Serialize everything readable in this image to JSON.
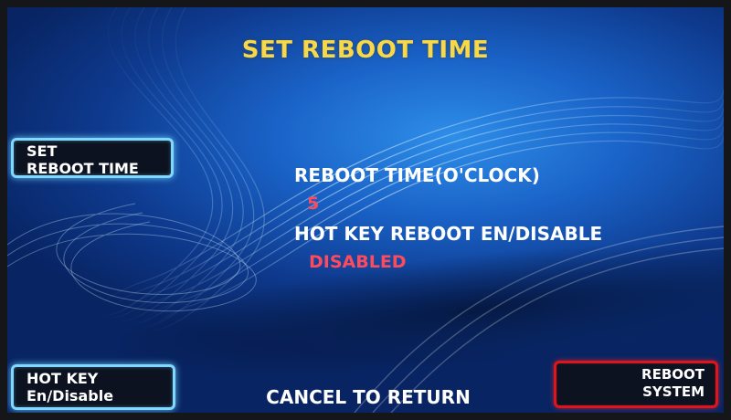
{
  "screen": {
    "title": "SET REBOOT TIME"
  },
  "left_buttons": {
    "set_reboot_time": {
      "line1": "SET",
      "line2": "REBOOT TIME"
    },
    "hot_key": {
      "line1": "HOT KEY",
      "line2": "En/Disable"
    }
  },
  "right_buttons": {
    "reboot_system": {
      "line1": "REBOOT",
      "line2": "SYSTEM"
    }
  },
  "settings": {
    "reboot_time_label": "REBOOT TIME(O'CLOCK)",
    "reboot_time_value": "5",
    "hot_key_label": "HOT KEY REBOOT EN/DISABLE",
    "hot_key_value": "DISABLED"
  },
  "footer": {
    "cancel_text": "CANCEL TO RETURN"
  },
  "colors": {
    "title": "#f7d84a",
    "value": "#ff4a5e",
    "button_glow": "#7fd8ff",
    "selected_border": "#e0151b",
    "background": "#1a63c8"
  }
}
